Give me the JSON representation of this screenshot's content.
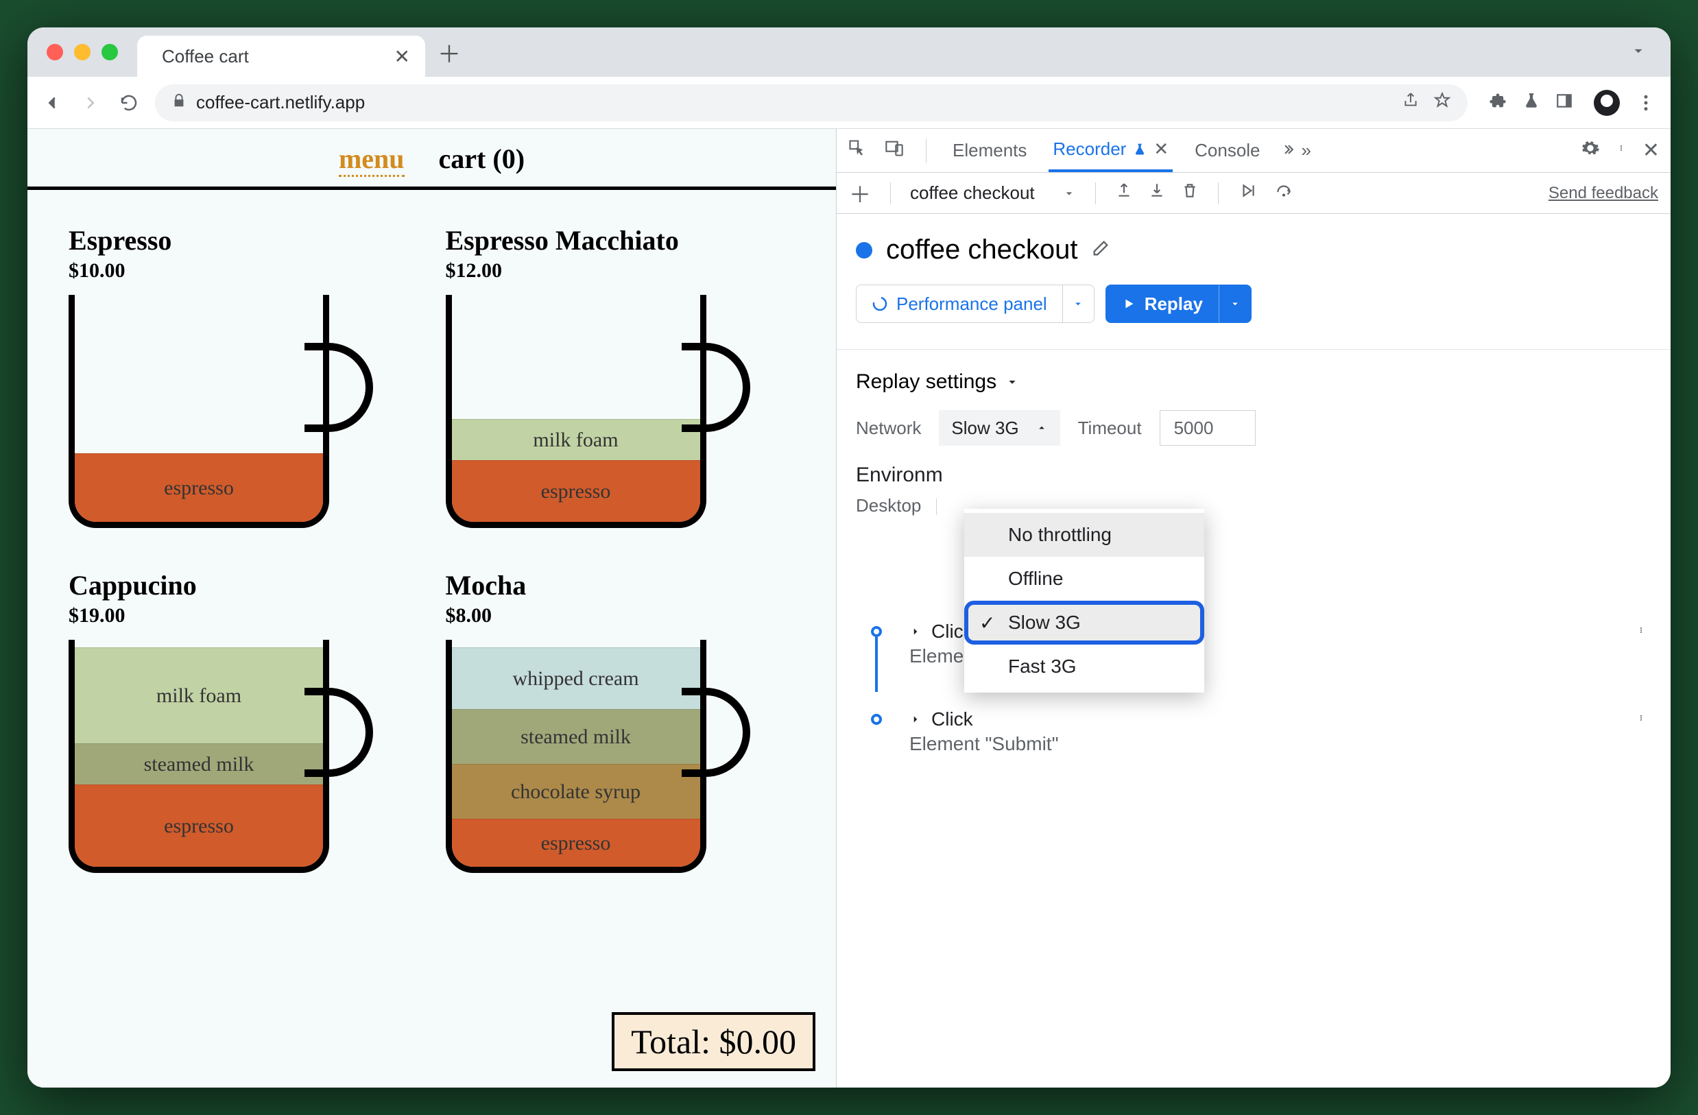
{
  "browser": {
    "tab_title": "Coffee cart",
    "url": "coffee-cart.netlify.app"
  },
  "page": {
    "nav": {
      "menu": "menu",
      "cart": "cart (0)"
    },
    "products": [
      {
        "name": "Espresso",
        "price": "$10.00",
        "layers": [
          [
            "espresso",
            "c-espresso"
          ]
        ]
      },
      {
        "name": "Espresso Macchiato",
        "price": "$12.00",
        "layers": [
          [
            "milk foam",
            "c-milkfoam"
          ],
          [
            "espresso",
            "c-espresso3"
          ]
        ]
      },
      {
        "name": "Cappucino",
        "price": "$19.00",
        "layers": [
          [
            "milk foam",
            "c-milkfoam2"
          ],
          [
            "steamed milk",
            "c-steamed2"
          ],
          [
            "espresso",
            "c-espresso2"
          ]
        ]
      },
      {
        "name": "Mocha",
        "price": "$8.00",
        "layers": [
          [
            "whipped cream",
            "c-whip2"
          ],
          [
            "steamed milk",
            "c-steamed3"
          ],
          [
            "chocolate syrup",
            "c-choco2"
          ],
          [
            "espresso",
            "c-esp4"
          ]
        ]
      }
    ],
    "total": "Total: $0.00"
  },
  "devtools": {
    "tabs": {
      "elements": "Elements",
      "recorder": "Recorder",
      "console": "Console"
    },
    "toolbar": {
      "recording_select": "coffee checkout",
      "feedback": "Send feedback"
    },
    "title": "coffee checkout",
    "buttons": {
      "perf": "Performance panel",
      "replay": "Replay"
    },
    "settings": {
      "heading": "Replay settings",
      "network_label": "Network",
      "network_value": "Slow 3G",
      "timeout_label": "Timeout",
      "timeout_value": "5000",
      "env_heading": "Environm",
      "env_sub": "Desktop"
    },
    "network_options": [
      "No throttling",
      "Offline",
      "Slow 3G",
      "Fast 3G"
    ],
    "steps": [
      {
        "action": "Click",
        "target": "Element \"Promotion message\""
      },
      {
        "action": "Click",
        "target": "Element \"Submit\""
      }
    ]
  }
}
